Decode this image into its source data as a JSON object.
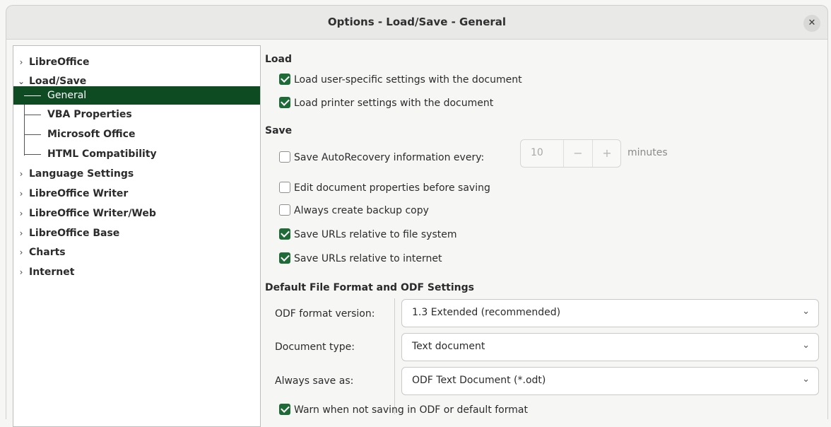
{
  "window": {
    "title": "Options - Load/Save - General",
    "close_icon": "close-icon"
  },
  "tree": {
    "items": [
      {
        "label": "LibreOffice",
        "expanded": false
      },
      {
        "label": "Load/Save",
        "expanded": true
      },
      {
        "label": "General",
        "selected": true
      },
      {
        "label": "VBA Properties"
      },
      {
        "label": "Microsoft Office"
      },
      {
        "label": "HTML Compatibility"
      },
      {
        "label": "Language Settings",
        "expanded": false
      },
      {
        "label": "LibreOffice Writer",
        "expanded": false
      },
      {
        "label": "LibreOffice Writer/Web",
        "expanded": false
      },
      {
        "label": "LibreOffice Base",
        "expanded": false
      },
      {
        "label": "Charts",
        "expanded": false
      },
      {
        "label": "Internet",
        "expanded": false
      }
    ],
    "selection_color": "#0e4b23"
  },
  "load": {
    "title": "Load",
    "user_settings": {
      "label": "Load user-specific settings with the document",
      "checked": true
    },
    "printer_settings": {
      "label": "Load printer settings with the document",
      "checked": true
    }
  },
  "save": {
    "title": "Save",
    "autorecovery": {
      "label": "Save AutoRecovery information every:",
      "checked": false
    },
    "autorecovery_value": "10",
    "autorecovery_unit": "minutes",
    "edit_properties": {
      "label": "Edit document properties before saving",
      "checked": false
    },
    "backup_copy": {
      "label": "Always create backup copy",
      "checked": false
    },
    "urls_file_system": {
      "label": "Save URLs relative to file system",
      "checked": true
    },
    "urls_internet": {
      "label": "Save URLs relative to internet",
      "checked": true
    }
  },
  "defaults": {
    "title": "Default File Format and ODF Settings",
    "odf_version_label": "ODF format version:",
    "odf_version_value": "1.3 Extended (recommended)",
    "document_type_label": "Document type:",
    "document_type_value": "Text document",
    "save_as_label": "Always save as:",
    "save_as_value": "ODF Text Document (*.odt)",
    "warn": {
      "label": "Warn when not saving in ODF or default format",
      "checked": true
    }
  },
  "colors": {
    "check_accent": "#1d6b36"
  }
}
